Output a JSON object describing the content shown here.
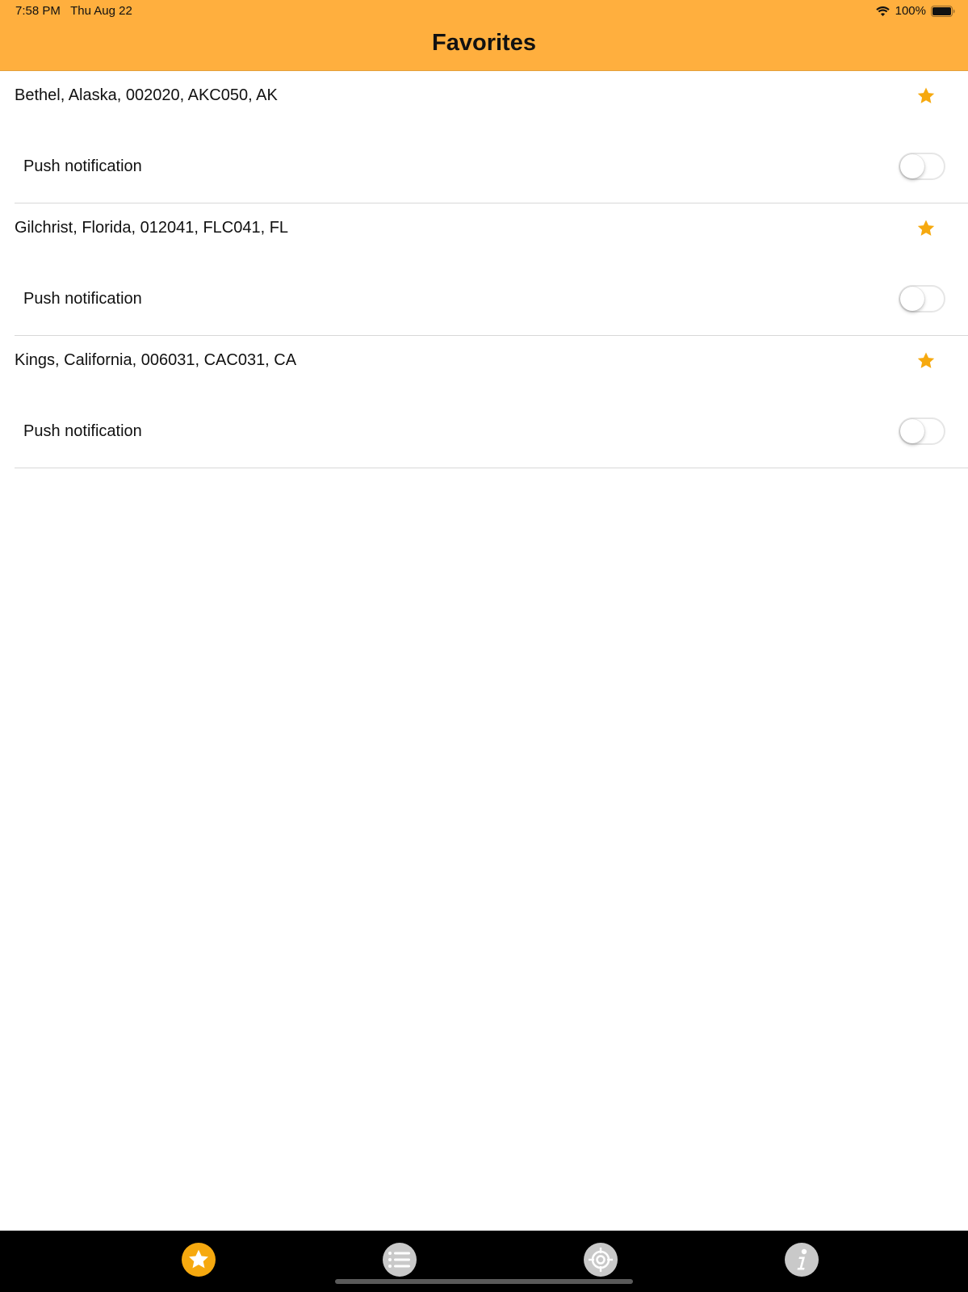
{
  "status_bar": {
    "time_date": "7:58 PM   Thu Aug 22",
    "battery": "100%"
  },
  "header": {
    "title": "Favorites"
  },
  "favorites": [
    {
      "name": "Bethel, Alaska, 002020, AKC050, AK",
      "push_label": "Push notification",
      "push_enabled": false
    },
    {
      "name": "Gilchrist, Florida, 012041, FLC041, FL",
      "push_label": "Push notification",
      "push_enabled": false
    },
    {
      "name": "Kings, California, 006031, CAC031, CA",
      "push_label": "Push notification",
      "push_enabled": false
    }
  ],
  "tab_bar": {
    "tabs": [
      {
        "icon": "star-icon",
        "active": true
      },
      {
        "icon": "list-icon",
        "active": false
      },
      {
        "icon": "location-target-icon",
        "active": false
      },
      {
        "icon": "info-icon",
        "active": false
      }
    ]
  },
  "colors": {
    "header_background": "#FFAF3E",
    "accent": "#F6A90F",
    "tab_bar_background": "#000000",
    "tab_inactive": "#C9C9C9"
  }
}
